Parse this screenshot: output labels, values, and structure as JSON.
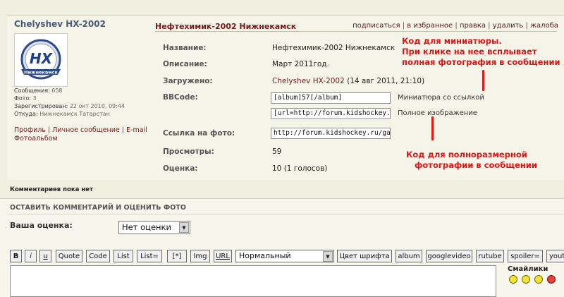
{
  "user": {
    "name": "Chelyshev HX-2002",
    "logo_text": "НХ",
    "logo_subtitle": "Нижнекамск",
    "stats": [
      {
        "label": "Сообщения:",
        "value": "658"
      },
      {
        "label": "Фото:",
        "value": "3"
      },
      {
        "label": "Зарегистрирован:",
        "value": "22 окт 2010, 09:44"
      },
      {
        "label": "Откуда:",
        "value": "Нижнекамск Татарстан"
      }
    ],
    "links": [
      "Профиль",
      "Личное сообщение",
      "E-mail",
      "Фотоальбом"
    ]
  },
  "photo": {
    "title": "Нефтехимик-2002 Нижнекамск",
    "actions": [
      "подписаться",
      "в избранное",
      "правка",
      "удалить",
      "жалоба"
    ],
    "rows": {
      "name_label": "Название:",
      "name_value": "Нефтехимик-2002 Нижнекамск",
      "desc_label": "Описание:",
      "desc_value": "Март 2011год.",
      "uploaded_label": "Загружено:",
      "uploaded_user": "Chelyshev HX-2002",
      "uploaded_date": "(14 авг 2011, 21:10)",
      "bbcode_label": "BBCode:",
      "bbcode_thumb": "[album]57[/album]",
      "bbcode_thumb_hint": "Миниатюра со ссылкой",
      "bbcode_full": "[url=http://forum.kidshockey.ru",
      "bbcode_full_hint": "Полное изображение",
      "link_label": "Ссылка на фото:",
      "link_value": "http://forum.kidshockey.ru/gall",
      "views_label": "Просмотры:",
      "views_value": "59",
      "rating_label": "Оценка:",
      "rating_value": "10 (1 голосов)"
    }
  },
  "annotations": {
    "thumb": [
      "Код для миниатюры.",
      "При клике на нее всплывает",
      "полная фотография в сообщении"
    ],
    "full": [
      "Код для полноразмерной",
      "фотографии в сообщении"
    ],
    "color": "#d81818"
  },
  "comments": {
    "none": "Комментариев пока нет",
    "header": "ОСТАВИТЬ КОММЕНТАРИЙ И ОЦЕНИТЬ ФОТО",
    "rating_label": "Ваша оценка:",
    "rating_selected": "Нет оценки",
    "toolbar": [
      "B",
      "i",
      "u",
      "Quote",
      "Code",
      "List",
      "List=",
      "[*]",
      "Img",
      "URL"
    ],
    "font_size_selected": "Нормальный",
    "toolbar2": [
      "Цвет шрифта",
      "album",
      "googlevideo",
      "rutube",
      "spoiler=",
      "yout"
    ],
    "smilies_label": "Смайлики"
  },
  "colors": {
    "accent": "#7a1a1a",
    "background": "#efefe0"
  }
}
